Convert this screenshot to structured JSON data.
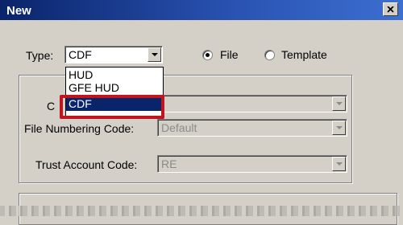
{
  "window": {
    "title": "New"
  },
  "form": {
    "type_label": "Type:",
    "type_value": "CDF",
    "radio_file": {
      "label": "File",
      "checked": true
    },
    "radio_template": {
      "label": "Template",
      "checked": false
    },
    "code_label_partial": "C",
    "file_numbering_label": "File Numbering Code:",
    "file_numbering_value": "Default",
    "trust_account_label": "Trust Account Code:",
    "trust_account_value": "RE"
  },
  "dropdown": {
    "options": [
      "HUD",
      "GFE HUD",
      "CDF"
    ],
    "selected": "CDF"
  },
  "colors": {
    "highlight": "#c0151e",
    "selection": "#0a246a",
    "titlebar": "#0a246a"
  }
}
